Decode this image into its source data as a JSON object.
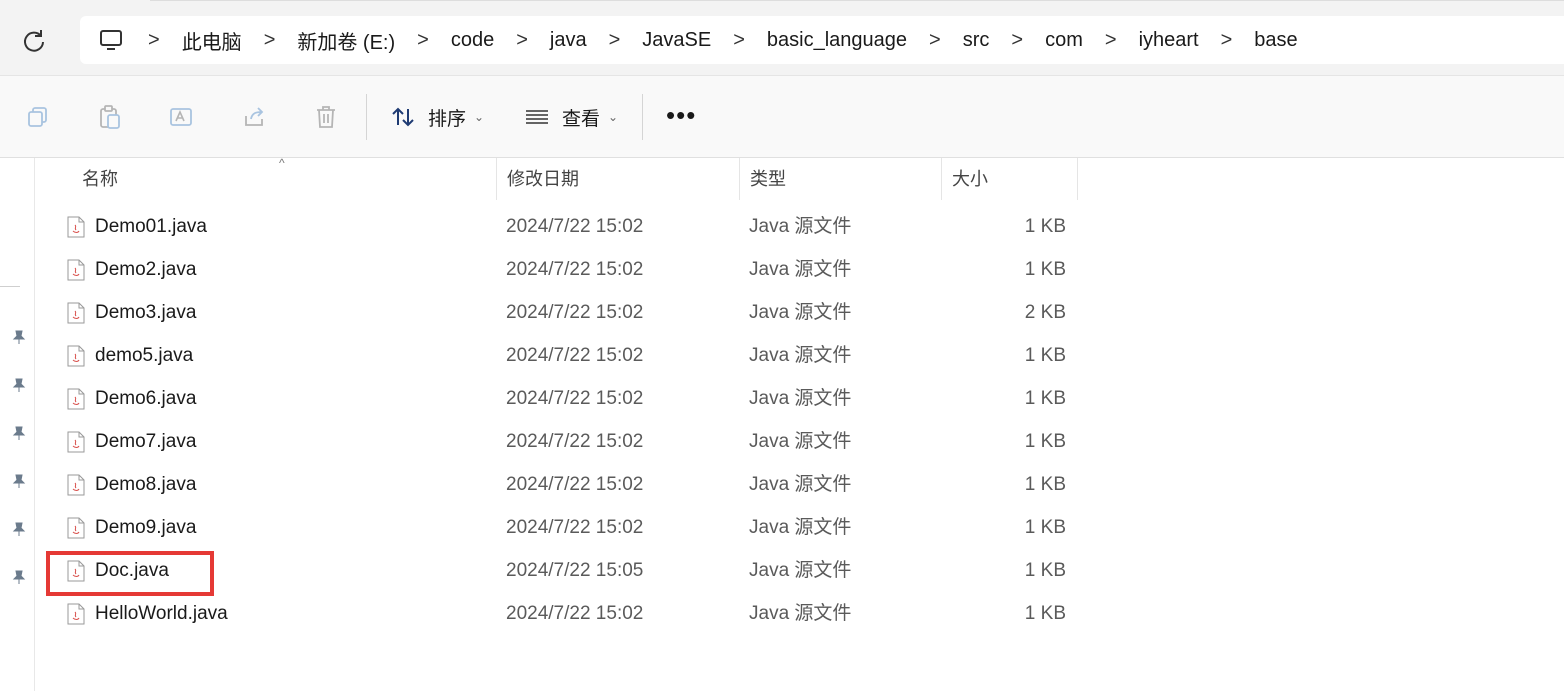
{
  "address": {
    "breadcrumbs": [
      "此电脑",
      "新加卷 (E:)",
      "code",
      "java",
      "JavaSE",
      "basic_language",
      "src",
      "com",
      "iyheart",
      "base"
    ],
    "separator": ">"
  },
  "toolbar": {
    "sort_label": "排序",
    "view_label": "查看",
    "more_label": "•••"
  },
  "columns": {
    "name": "名称",
    "modified": "修改日期",
    "type": "类型",
    "size": "大小"
  },
  "files": [
    {
      "name": "Demo01.java",
      "modified": "2024/7/22 15:02",
      "type": "Java 源文件",
      "size": "1 KB"
    },
    {
      "name": "Demo2.java",
      "modified": "2024/7/22 15:02",
      "type": "Java 源文件",
      "size": "1 KB"
    },
    {
      "name": "Demo3.java",
      "modified": "2024/7/22 15:02",
      "type": "Java 源文件",
      "size": "2 KB"
    },
    {
      "name": "demo5.java",
      "modified": "2024/7/22 15:02",
      "type": "Java 源文件",
      "size": "1 KB"
    },
    {
      "name": "Demo6.java",
      "modified": "2024/7/22 15:02",
      "type": "Java 源文件",
      "size": "1 KB"
    },
    {
      "name": "Demo7.java",
      "modified": "2024/7/22 15:02",
      "type": "Java 源文件",
      "size": "1 KB"
    },
    {
      "name": "Demo8.java",
      "modified": "2024/7/22 15:02",
      "type": "Java 源文件",
      "size": "1 KB"
    },
    {
      "name": "Demo9.java",
      "modified": "2024/7/22 15:02",
      "type": "Java 源文件",
      "size": "1 KB"
    },
    {
      "name": "Doc.java",
      "modified": "2024/7/22 15:05",
      "type": "Java 源文件",
      "size": "1 KB"
    },
    {
      "name": "HelloWorld.java",
      "modified": "2024/7/22 15:02",
      "type": "Java 源文件",
      "size": "1 KB"
    }
  ],
  "highlight_color": "#e53935"
}
